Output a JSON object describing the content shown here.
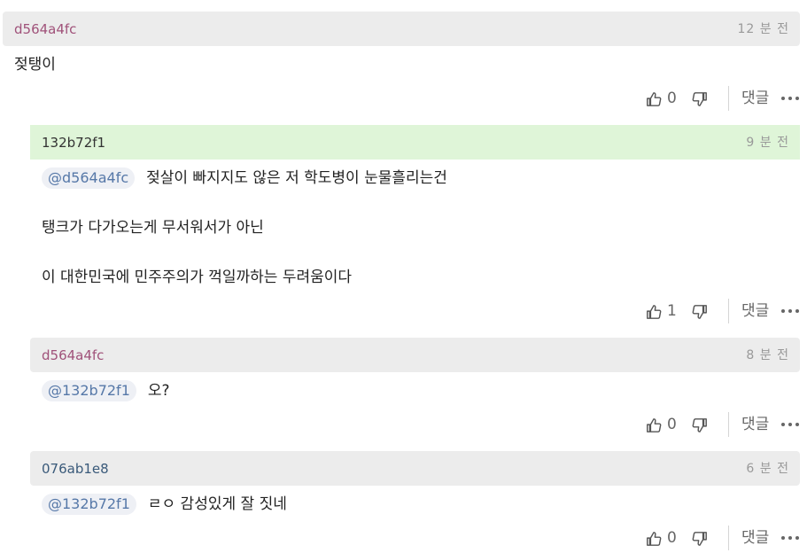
{
  "comments": [
    {
      "author": "d564a4fc",
      "author_color": "#a0527a",
      "time": "12 분 전",
      "mention": "",
      "lines": [
        "젖탱이"
      ],
      "likes": "0",
      "reply_label": "댓글"
    },
    {
      "author": "132b72f1",
      "author_color": "#333333",
      "time": "9 분 전",
      "mention": "@d564a4fc",
      "lines": [
        "젖살이 빠지지도 않은 저 학도병이 눈물흘리는건",
        "탱크가 다가오는게 무서워서가 아닌",
        "이 대한민국에 민주주의가 꺽일까하는 두려움이다"
      ],
      "likes": "1",
      "reply_label": "댓글"
    },
    {
      "author": "d564a4fc",
      "author_color": "#a0527a",
      "time": "8 분 전",
      "mention": "@132b72f1",
      "lines": [
        "오?"
      ],
      "likes": "0",
      "reply_label": "댓글"
    },
    {
      "author": "076ab1e8",
      "author_color": "#3a5a7a",
      "time": "6 분 전",
      "mention": "@132b72f1",
      "lines": [
        "ㄹㅇ 감성있게 잘 짓네"
      ],
      "likes": "0",
      "reply_label": "댓글"
    }
  ],
  "icons": {
    "like": "thumbs-up-icon",
    "dislike": "thumbs-down-icon",
    "more": "more-dots-icon"
  }
}
